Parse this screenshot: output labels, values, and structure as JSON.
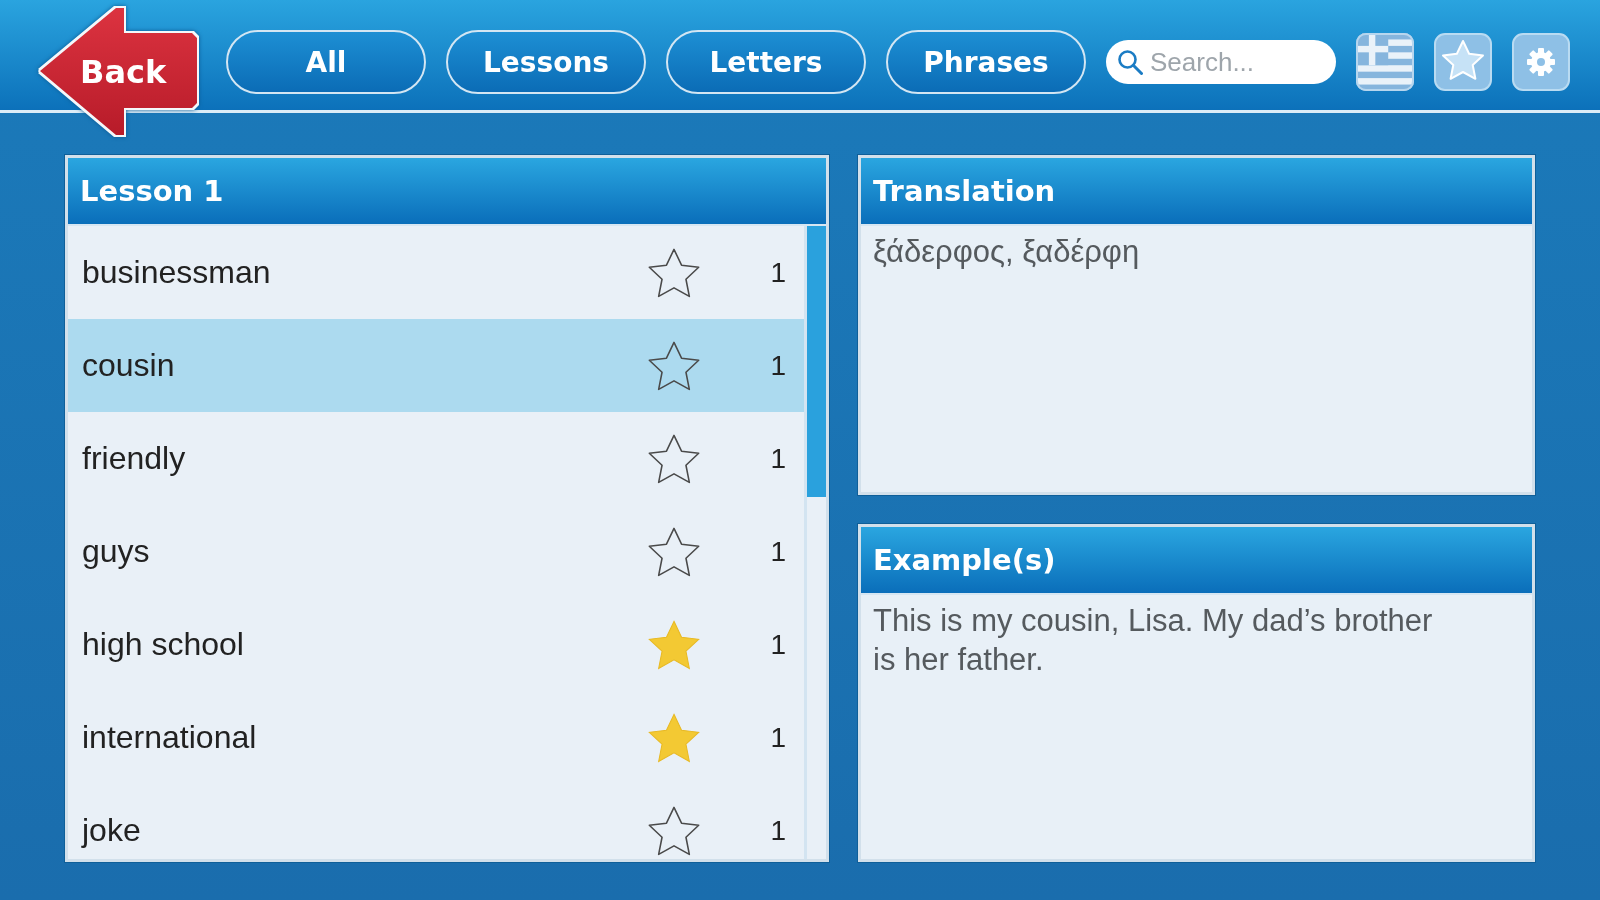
{
  "toolbar": {
    "back_button": "Back",
    "filters": [
      {
        "label": "All",
        "selected": false
      },
      {
        "label": "Lessons",
        "selected": false
      },
      {
        "label": "Letters",
        "selected": false
      },
      {
        "label": "Phrases",
        "selected": false
      }
    ],
    "search": {
      "placeholder": "Search..."
    }
  },
  "lesson": {
    "title": "Lesson 1",
    "rows": [
      {
        "word": "businessman",
        "favorite": false,
        "count": "1",
        "selected": false
      },
      {
        "word": "cousin",
        "favorite": false,
        "count": "1",
        "selected": true
      },
      {
        "word": "friendly",
        "favorite": false,
        "count": "1",
        "selected": false
      },
      {
        "word": "guys",
        "favorite": false,
        "count": "1",
        "selected": false
      },
      {
        "word": "high school",
        "favorite": true,
        "count": "1",
        "selected": false
      },
      {
        "word": "international",
        "favorite": true,
        "count": "1",
        "selected": false
      },
      {
        "word": "joke",
        "favorite": false,
        "count": "1",
        "selected": false
      }
    ]
  },
  "translation": {
    "title": "Translation",
    "text": "ξάδερφος, ξαδέρφη"
  },
  "examples": {
    "title": "Example(s)",
    "text": "This is my cousin, Lisa. My dad’s brother is her father."
  }
}
